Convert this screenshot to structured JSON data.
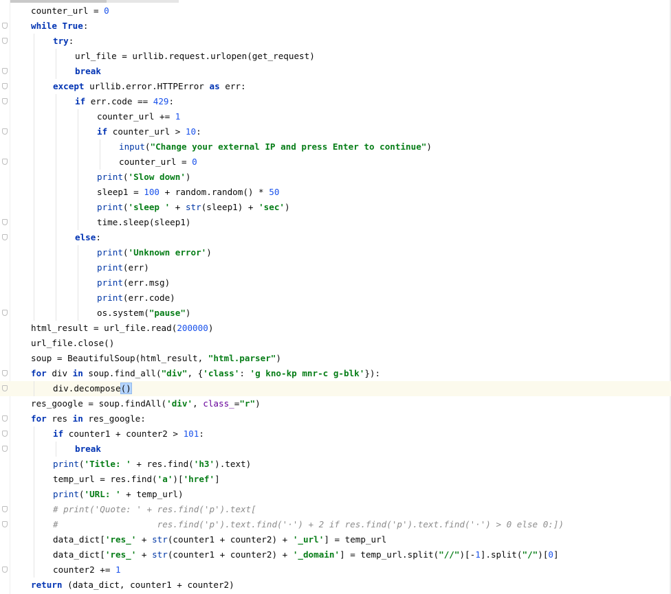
{
  "editor": {
    "language": "python",
    "current_line": 26,
    "lines": [
      {
        "indent": 0,
        "fold": false,
        "tokens": [
          [
            "t",
            "counter_url = "
          ],
          [
            "num",
            "0"
          ]
        ]
      },
      {
        "indent": 0,
        "fold": true,
        "tokens": [
          [
            "kw",
            "while"
          ],
          [
            "t",
            " "
          ],
          [
            "kw",
            "True"
          ],
          [
            "t",
            ":"
          ]
        ]
      },
      {
        "indent": 1,
        "fold": true,
        "tokens": [
          [
            "kw",
            "try"
          ],
          [
            "t",
            ":"
          ]
        ]
      },
      {
        "indent": 2,
        "fold": false,
        "tokens": [
          [
            "t",
            "url_file = urllib.request.urlopen(get_request)"
          ]
        ]
      },
      {
        "indent": 2,
        "fold": true,
        "tokens": [
          [
            "kw",
            "break"
          ]
        ]
      },
      {
        "indent": 1,
        "fold": true,
        "tokens": [
          [
            "kw",
            "except"
          ],
          [
            "t",
            " urllib.error.HTTPError "
          ],
          [
            "kw",
            "as"
          ],
          [
            "t",
            " err:"
          ]
        ]
      },
      {
        "indent": 2,
        "fold": true,
        "tokens": [
          [
            "kw",
            "if"
          ],
          [
            "t",
            " err.code == "
          ],
          [
            "num",
            "429"
          ],
          [
            "t",
            ":"
          ]
        ]
      },
      {
        "indent": 3,
        "fold": false,
        "tokens": [
          [
            "t",
            "counter_url += "
          ],
          [
            "num",
            "1"
          ]
        ]
      },
      {
        "indent": 3,
        "fold": true,
        "tokens": [
          [
            "kw",
            "if"
          ],
          [
            "t",
            " counter_url > "
          ],
          [
            "num",
            "10"
          ],
          [
            "t",
            ":"
          ]
        ]
      },
      {
        "indent": 4,
        "fold": false,
        "tokens": [
          [
            "bi",
            "input"
          ],
          [
            "t",
            "("
          ],
          [
            "str",
            "\"Change your external IP and press Enter to continue\""
          ],
          [
            "t",
            ")"
          ]
        ]
      },
      {
        "indent": 4,
        "fold": true,
        "tokens": [
          [
            "t",
            "counter_url = "
          ],
          [
            "num",
            "0"
          ]
        ]
      },
      {
        "indent": 3,
        "fold": false,
        "tokens": [
          [
            "bi",
            "print"
          ],
          [
            "t",
            "("
          ],
          [
            "str",
            "'Slow down'"
          ],
          [
            "t",
            ")"
          ]
        ]
      },
      {
        "indent": 3,
        "fold": false,
        "tokens": [
          [
            "t",
            "sleep1 = "
          ],
          [
            "num",
            "100"
          ],
          [
            "t",
            " + random.random() * "
          ],
          [
            "num",
            "50"
          ]
        ]
      },
      {
        "indent": 3,
        "fold": false,
        "tokens": [
          [
            "bi",
            "print"
          ],
          [
            "t",
            "("
          ],
          [
            "str",
            "'sleep '"
          ],
          [
            "t",
            " + "
          ],
          [
            "bi",
            "str"
          ],
          [
            "t",
            "(sleep1) + "
          ],
          [
            "str",
            "'sec'"
          ],
          [
            "t",
            ")"
          ]
        ]
      },
      {
        "indent": 3,
        "fold": true,
        "tokens": [
          [
            "t",
            "time.sleep(sleep1)"
          ]
        ]
      },
      {
        "indent": 2,
        "fold": true,
        "tokens": [
          [
            "kw",
            "else"
          ],
          [
            "t",
            ":"
          ]
        ]
      },
      {
        "indent": 3,
        "fold": false,
        "tokens": [
          [
            "bi",
            "print"
          ],
          [
            "t",
            "("
          ],
          [
            "str",
            "'Unknown error'"
          ],
          [
            "t",
            ")"
          ]
        ]
      },
      {
        "indent": 3,
        "fold": false,
        "tokens": [
          [
            "bi",
            "print"
          ],
          [
            "t",
            "(err)"
          ]
        ]
      },
      {
        "indent": 3,
        "fold": false,
        "tokens": [
          [
            "bi",
            "print"
          ],
          [
            "t",
            "(err.msg)"
          ]
        ]
      },
      {
        "indent": 3,
        "fold": false,
        "tokens": [
          [
            "bi",
            "print"
          ],
          [
            "t",
            "(err.code)"
          ]
        ]
      },
      {
        "indent": 3,
        "fold": true,
        "tokens": [
          [
            "t",
            "os.system("
          ],
          [
            "str",
            "\"pause\""
          ],
          [
            "t",
            ")"
          ]
        ]
      },
      {
        "indent": 0,
        "fold": false,
        "tokens": [
          [
            "t",
            "html_result = url_file.read("
          ],
          [
            "num",
            "200000"
          ],
          [
            "t",
            ")"
          ]
        ]
      },
      {
        "indent": 0,
        "fold": false,
        "tokens": [
          [
            "t",
            "url_file.close()"
          ]
        ]
      },
      {
        "indent": 0,
        "fold": false,
        "tokens": [
          [
            "t",
            "soup = BeautifulSoup(html_result, "
          ],
          [
            "str",
            "\"html.parser\""
          ],
          [
            "t",
            ")"
          ]
        ]
      },
      {
        "indent": 0,
        "fold": true,
        "tokens": [
          [
            "kw",
            "for"
          ],
          [
            "t",
            " div "
          ],
          [
            "kw",
            "in"
          ],
          [
            "t",
            " soup.find_all("
          ],
          [
            "str",
            "\"div\""
          ],
          [
            "t",
            ", {"
          ],
          [
            "str",
            "'class'"
          ],
          [
            "t",
            ": "
          ],
          [
            "str",
            "'g kno-kp mnr-c g-blk'"
          ],
          [
            "t",
            "}):"
          ]
        ]
      },
      {
        "indent": 1,
        "fold": true,
        "tokens": [
          [
            "t",
            "div.decompose"
          ],
          [
            "brk",
            "()"
          ]
        ]
      },
      {
        "indent": 0,
        "fold": false,
        "tokens": [
          [
            "t",
            "res_google = soup.findAll("
          ],
          [
            "str",
            "'div'"
          ],
          [
            "t",
            ", "
          ],
          [
            "kwarg",
            "class_"
          ],
          [
            "t",
            "="
          ],
          [
            "str",
            "\"r\""
          ],
          [
            "t",
            ")"
          ]
        ]
      },
      {
        "indent": 0,
        "fold": true,
        "tokens": [
          [
            "kw",
            "for"
          ],
          [
            "t",
            " res "
          ],
          [
            "kw",
            "in"
          ],
          [
            "t",
            " res_google:"
          ]
        ]
      },
      {
        "indent": 1,
        "fold": true,
        "tokens": [
          [
            "kw",
            "if"
          ],
          [
            "t",
            " counter1 + counter2 > "
          ],
          [
            "num",
            "101"
          ],
          [
            "t",
            ":"
          ]
        ]
      },
      {
        "indent": 2,
        "fold": true,
        "tokens": [
          [
            "kw",
            "break"
          ]
        ]
      },
      {
        "indent": 1,
        "fold": false,
        "tokens": [
          [
            "bi",
            "print"
          ],
          [
            "t",
            "("
          ],
          [
            "str",
            "'Title: '"
          ],
          [
            "t",
            " + res.find("
          ],
          [
            "str",
            "'h3'"
          ],
          [
            "t",
            ").text)"
          ]
        ]
      },
      {
        "indent": 1,
        "fold": false,
        "tokens": [
          [
            "t",
            "temp_url = res.find("
          ],
          [
            "str",
            "'a'"
          ],
          [
            "t",
            ")["
          ],
          [
            "str",
            "'href'"
          ],
          [
            "t",
            "]"
          ]
        ]
      },
      {
        "indent": 1,
        "fold": false,
        "tokens": [
          [
            "bi",
            "print"
          ],
          [
            "t",
            "("
          ],
          [
            "str",
            "'URL: '"
          ],
          [
            "t",
            " + temp_url)"
          ]
        ]
      },
      {
        "indent": 1,
        "fold": true,
        "tokens": [
          [
            "cm",
            "# print('Quote: ' + res.find('p').text["
          ]
        ]
      },
      {
        "indent": 1,
        "fold": true,
        "tokens": [
          [
            "cm",
            "#                   res.find('p').text.find('·') + 2 if res.find('p').text.find('·') > 0 else 0:])"
          ]
        ]
      },
      {
        "indent": 1,
        "fold": false,
        "tokens": [
          [
            "t",
            "data_dict["
          ],
          [
            "str",
            "'res_'"
          ],
          [
            "t",
            " + "
          ],
          [
            "bi",
            "str"
          ],
          [
            "t",
            "(counter1 + counter2) + "
          ],
          [
            "str",
            "'_url'"
          ],
          [
            "t",
            "] = temp_url"
          ]
        ]
      },
      {
        "indent": 1,
        "fold": false,
        "tokens": [
          [
            "t",
            "data_dict["
          ],
          [
            "str",
            "'res_'"
          ],
          [
            "t",
            " + "
          ],
          [
            "bi",
            "str"
          ],
          [
            "t",
            "(counter1 + counter2) + "
          ],
          [
            "str",
            "'_domain'"
          ],
          [
            "t",
            "] = temp_url.split("
          ],
          [
            "str",
            "\"//\""
          ],
          [
            "t",
            ")[-"
          ],
          [
            "num",
            "1"
          ],
          [
            "t",
            "].split("
          ],
          [
            "str",
            "\"/\""
          ],
          [
            "t",
            ")["
          ],
          [
            "num",
            "0"
          ],
          [
            "t",
            "]"
          ]
        ]
      },
      {
        "indent": 1,
        "fold": true,
        "tokens": [
          [
            "t",
            "counter2 += "
          ],
          [
            "num",
            "1"
          ]
        ]
      },
      {
        "indent": 0,
        "fold": false,
        "tokens": [
          [
            "kw",
            "return"
          ],
          [
            "t",
            " (data_dict, counter1 + counter2)"
          ]
        ]
      }
    ]
  }
}
